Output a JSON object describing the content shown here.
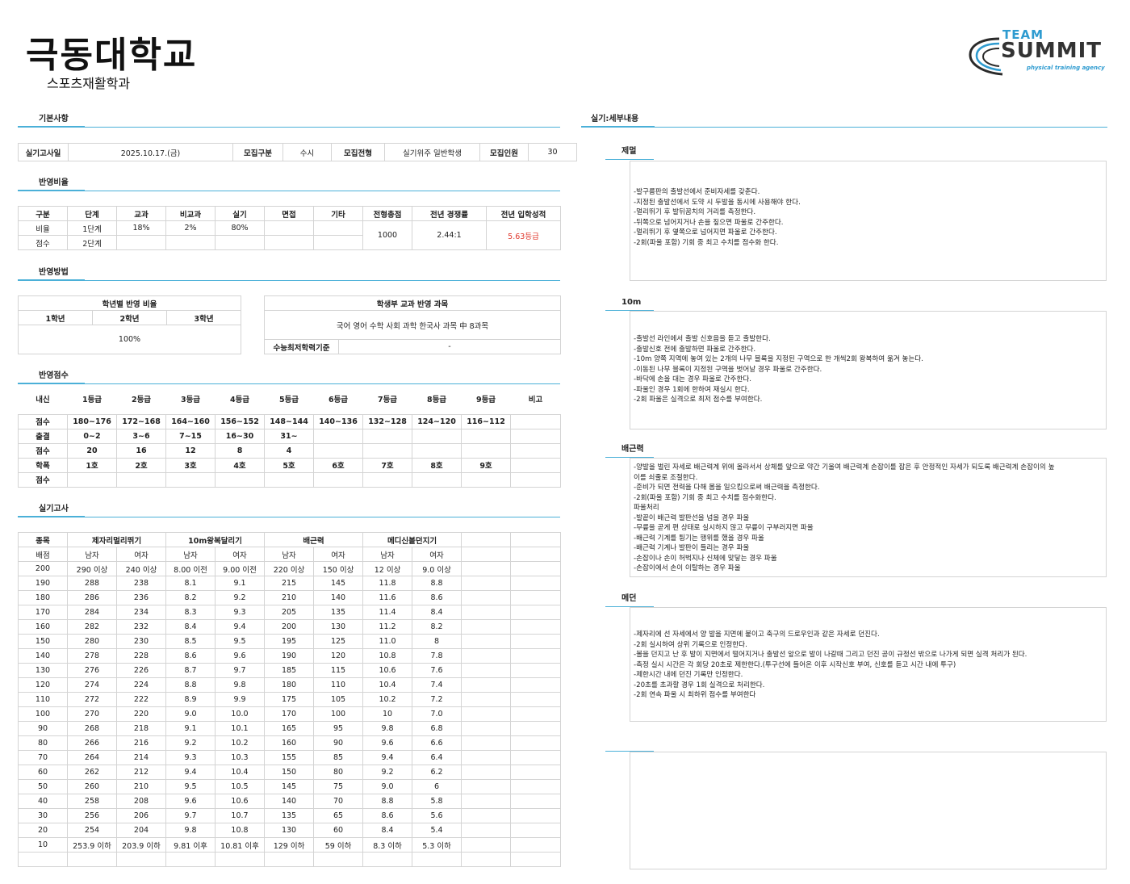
{
  "header": {
    "title": "극동대학교",
    "subtitle": "스포츠재활학과"
  },
  "logo": {
    "team": "TEAM",
    "brand": "SUMMIT",
    "tagline": "physical training agency"
  },
  "sections": {
    "basic": "기본사항",
    "ratio": "반영비율",
    "method": "반영방법",
    "score": "반영점수",
    "exam": "실기고사",
    "detail": "실기:세부내용"
  },
  "basic": {
    "date_label": "실기고사일",
    "date": "2025.10.17.(금)",
    "type_label": "모집구분",
    "type": "수시",
    "track_label": "모집전형",
    "track": "실기위주 일반학생",
    "count_label": "모집인원",
    "count": "30"
  },
  "ratio": {
    "headers": [
      "구분",
      "단계",
      "교과",
      "비교과",
      "실기",
      "면접",
      "기타",
      "전형총점",
      "전년 경쟁률",
      "전년 입학성적"
    ],
    "row1": [
      "비율",
      "1단계",
      "18%",
      "2%",
      "80%",
      "",
      ""
    ],
    "row2": [
      "점수",
      "2단계",
      "",
      "",
      "",
      "",
      ""
    ],
    "total": "1000",
    "competition": "2.44:1",
    "prev_grade": "5.63등급"
  },
  "method": {
    "year_title": "학년별 반영 비율",
    "years": [
      "1학년",
      "2학년",
      "3학년"
    ],
    "year_value": "100%",
    "subject_title": "학생부 교과 반영 과목",
    "subjects": "국어 영어 수학 사회 과학 한국사 과목 中 8과목",
    "min_label": "수능최저학력기준",
    "min_value": "-"
  },
  "score": {
    "headers": [
      "내신",
      "1등급",
      "2등급",
      "3등급",
      "4등급",
      "5등급",
      "6등급",
      "7등급",
      "8등급",
      "9등급",
      "비고"
    ],
    "rows": [
      [
        "점수",
        "180~176",
        "172~168",
        "164~160",
        "156~152",
        "148~144",
        "140~136",
        "132~128",
        "124~120",
        "116~112",
        ""
      ],
      [
        "출결",
        "0~2",
        "3~6",
        "7~15",
        "16~30",
        "31~",
        "",
        "",
        "",
        "",
        ""
      ],
      [
        "점수",
        "20",
        "16",
        "12",
        "8",
        "4",
        "",
        "",
        "",
        "",
        ""
      ],
      [
        "학폭",
        "1호",
        "2호",
        "3호",
        "4호",
        "5호",
        "6호",
        "7호",
        "8호",
        "9호",
        ""
      ],
      [
        "점수",
        "",
        "",
        "",
        "",
        "",
        "",
        "",
        "",
        "",
        ""
      ]
    ]
  },
  "exam": {
    "h1": [
      "종목",
      "제자리멀리뛰기",
      "10m왕복달리기",
      "배근력",
      "메디신볼던지기"
    ],
    "h2": [
      "배점",
      "남자",
      "여자",
      "남자",
      "여자",
      "남자",
      "여자",
      "남자",
      "여자"
    ],
    "rows": [
      [
        "200",
        "290 이상",
        "240 이상",
        "8.00 이전",
        "9.00 이전",
        "220 이상",
        "150 이상",
        "12 이상",
        "9.0 이상"
      ],
      [
        "190",
        "288",
        "238",
        "8.1",
        "9.1",
        "215",
        "145",
        "11.8",
        "8.8"
      ],
      [
        "180",
        "286",
        "236",
        "8.2",
        "9.2",
        "210",
        "140",
        "11.6",
        "8.6"
      ],
      [
        "170",
        "284",
        "234",
        "8.3",
        "9.3",
        "205",
        "135",
        "11.4",
        "8.4"
      ],
      [
        "160",
        "282",
        "232",
        "8.4",
        "9.4",
        "200",
        "130",
        "11.2",
        "8.2"
      ],
      [
        "150",
        "280",
        "230",
        "8.5",
        "9.5",
        "195",
        "125",
        "11.0",
        "8"
      ],
      [
        "140",
        "278",
        "228",
        "8.6",
        "9.6",
        "190",
        "120",
        "10.8",
        "7.8"
      ],
      [
        "130",
        "276",
        "226",
        "8.7",
        "9.7",
        "185",
        "115",
        "10.6",
        "7.6"
      ],
      [
        "120",
        "274",
        "224",
        "8.8",
        "9.8",
        "180",
        "110",
        "10.4",
        "7.4"
      ],
      [
        "110",
        "272",
        "222",
        "8.9",
        "9.9",
        "175",
        "105",
        "10.2",
        "7.2"
      ],
      [
        "100",
        "270",
        "220",
        "9.0",
        "10.0",
        "170",
        "100",
        "10",
        "7.0"
      ],
      [
        "90",
        "268",
        "218",
        "9.1",
        "10.1",
        "165",
        "95",
        "9.8",
        "6.8"
      ],
      [
        "80",
        "266",
        "216",
        "9.2",
        "10.2",
        "160",
        "90",
        "9.6",
        "6.6"
      ],
      [
        "70",
        "264",
        "214",
        "9.3",
        "10.3",
        "155",
        "85",
        "9.4",
        "6.4"
      ],
      [
        "60",
        "262",
        "212",
        "9.4",
        "10.4",
        "150",
        "80",
        "9.2",
        "6.2"
      ],
      [
        "50",
        "260",
        "210",
        "9.5",
        "10.5",
        "145",
        "75",
        "9.0",
        "6"
      ],
      [
        "40",
        "258",
        "208",
        "9.6",
        "10.6",
        "140",
        "70",
        "8.8",
        "5.8"
      ],
      [
        "30",
        "256",
        "206",
        "9.7",
        "10.7",
        "135",
        "65",
        "8.6",
        "5.6"
      ],
      [
        "20",
        "254",
        "204",
        "9.8",
        "10.8",
        "130",
        "60",
        "8.4",
        "5.4"
      ],
      [
        "10",
        "253.9 이하",
        "203.9 이하",
        "9.81 이후",
        "10.81 이후",
        "129 이하",
        "59 이하",
        "8.3 이하",
        "5.3 이하"
      ],
      [
        "",
        "",
        "",
        "",
        "",
        "",
        "",
        "",
        ""
      ]
    ]
  },
  "details": [
    {
      "name": "제멀",
      "lines": [
        "-발구름판의 출발선에서 준비자세를 갖춘다.",
        "-지정된 출발선에서 도약 시 두발을 동시에 사용해야 한다.",
        "-멀리뛰기 후 발뒤꿈치의 거리를 측정한다.",
        "-뒤쪽으로 넘어지거나 손을 짚으면 파울로 간주한다.",
        "-멀리뛰기 후 옆쪽으로 넘어지면 파울로 간주한다.",
        "-2회(파울 포함) 기회 중 최고 수치를 점수화 한다."
      ]
    },
    {
      "name": "10m",
      "lines": [
        "-출발선 라인에서 출발 신호음을 듣고 출발한다.",
        "-출발신호 전에 출발하면 파울로 간주한다.",
        "-10m 양쪽 지역에 놓여 있는 2개의 나무 블록을 지정된 구역으로 한 개씩2회 왕복하여 옮겨 놓는다.",
        "-이동된 나무 블록이 지정된 구역을 벗어날 경우 파울로 간주한다.",
        "-바닥에 손을 대는 경우 파울로 간주한다.",
        "-파울인 경우 1회에 한하여 재실시 한다.",
        "-2회 파울은 실격으로 최저 점수를 부여한다."
      ]
    },
    {
      "name": "배근력",
      "lines": [
        "-양발을 벌린 자세로 배근력계 위에 올라서서 상체를 앞으로 약간 기울여 배근력계 손잡이를 잡은 후 안정적인 자세가 되도록 배근력계 손잡이의 높",
        "이를 쇠줄로 조절한다.",
        "-준비가 되면 전력을 다해 몸을 일으킴으로써 배근력을 측정한다.",
        "-2회(파울 포함) 기회 중 최고 수치를 점수화한다.",
        "파울처리",
        "-발끝이 배근력 발판선을 넘을 경우 파울",
        "-무릎을 곧게 편 상태로 실시하지 않고 무릎이 구부러지면 파울",
        "-배근력 기계를 튕기는 행위를 했을 경우 파울",
        "-배근력 기계나 발판이 들리는 경우 파울",
        "-손잡이나 손이 허벅지나 신체에 맞닿는 경우 파울",
        "-손잡이에서 손이 이탈하는 경우 파울"
      ]
    },
    {
      "name": "메던",
      "lines": [
        "-제자리에 선 자세에서 양 발을 지면에 붙이고 축구의 드로우인과 같은 자세로 던진다.",
        "-2회 실시하여 상위 기록으로 인정한다.",
        "-볼을 던지고 난 후 발이 지면에서 떨어지거나 출발선 앞으로 발이 나갈때 그리고 던진 공이 규정선 밖으로 나가게 되면 실격 처리가 된다.",
        "-측정 실시 시간은 각 회당 20초로 제한한다.(투구선에 들어온 이후 시작신호 부여, 신호를 듣고 시간 내에 투구)",
        "-제한시간 내에 던진 기록만 인정한다.",
        "-20초를 초과할 경우 1회 실격으로 처리한다.",
        "-2회 연속 파울 시 최하위 점수를 부여한다"
      ]
    },
    {
      "name": "",
      "lines": []
    }
  ]
}
